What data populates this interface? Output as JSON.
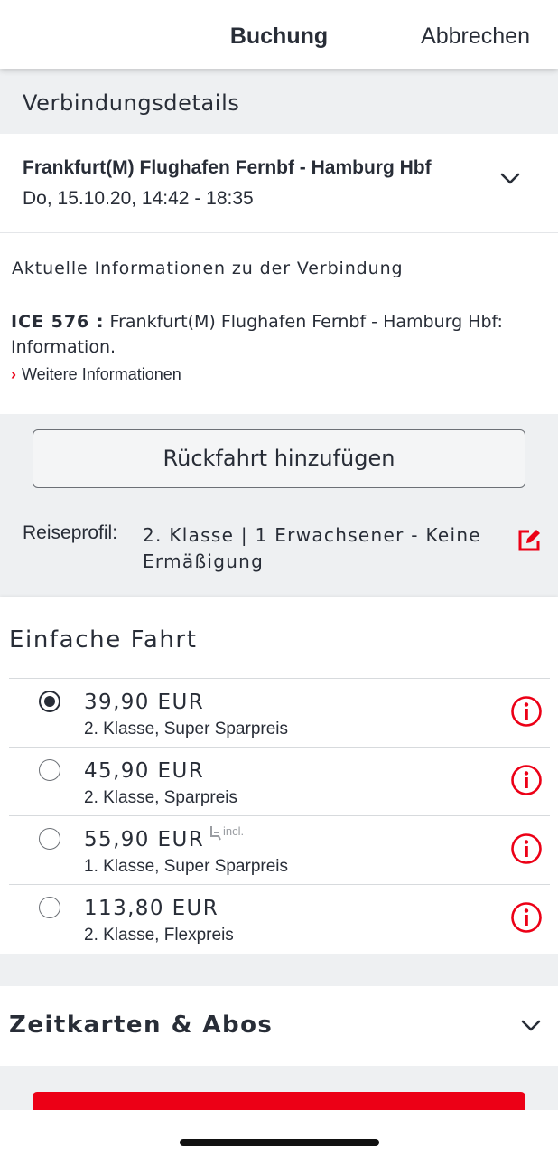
{
  "nav": {
    "title": "Buchung",
    "cancel": "Abbrechen"
  },
  "section": {
    "title": "Verbindungsdetails"
  },
  "connection": {
    "route": "Frankfurt(M) Flughafen Fernbf - Hamburg Hbf",
    "datetime": "Do, 15.10.20, 14:42 - 18:35"
  },
  "info": {
    "title": "Aktuelle Informationen zu der Verbindung",
    "train": "ICE 576 :",
    "text": "Frankfurt(M) Flughafen Fernbf - Hamburg Hbf: Information.",
    "link": "Weitere Informationen"
  },
  "return_button": "Rückfahrt hinzufügen",
  "profile": {
    "label": "Reiseprofil:",
    "value": "2. Klasse | 1 Erwachsener - Keine Ermäßigung"
  },
  "fares": {
    "title": "Einfache Fahrt",
    "items": [
      {
        "price": "39,90 EUR",
        "desc": "2. Klasse, Super Sparpreis",
        "selected": true
      },
      {
        "price": "45,90 EUR",
        "desc": "2. Klasse, Sparpreis",
        "selected": false
      },
      {
        "price": "55,90 EUR",
        "desc": "1. Klasse, Super Sparpreis",
        "selected": false,
        "badge": "incl."
      },
      {
        "price": "113,80 EUR",
        "desc": "2. Klasse, Flexpreis",
        "selected": false
      }
    ]
  },
  "season": {
    "title": "Zeitkarten & Abos"
  },
  "colors": {
    "accent": "#ec0016",
    "text": "#282d37",
    "background": "#eef0f2"
  },
  "icons": {
    "chevron": "chevron-down-icon",
    "edit": "edit-icon",
    "info": "info-icon",
    "seat": "seat-reservation-icon"
  }
}
